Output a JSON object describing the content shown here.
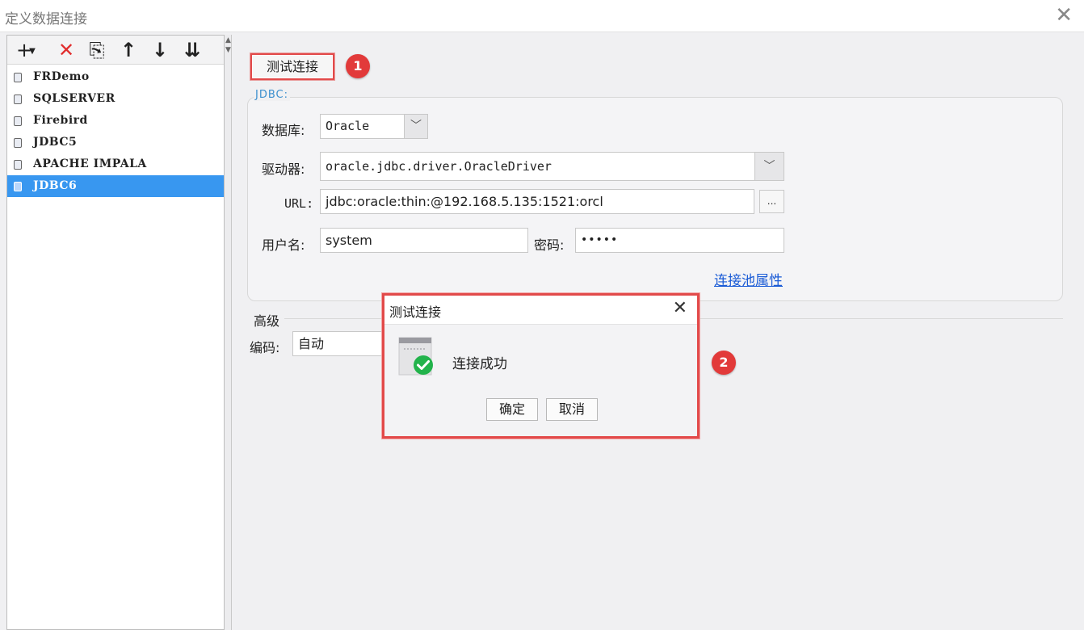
{
  "window": {
    "title": "定义数据连接",
    "close_glyph": "✕"
  },
  "toolbar": {
    "add_glyph": "+",
    "add_caret": "▼",
    "delete_glyph": "✕",
    "copy_glyph": "⎘",
    "up_glyph": "↑",
    "down_glyph": "↓",
    "sort_glyph": "⇊"
  },
  "connections": [
    {
      "label": "FRDemo"
    },
    {
      "label": "SQLSERVER"
    },
    {
      "label": "Firebird"
    },
    {
      "label": "JDBC5"
    },
    {
      "label": "APACHE IMPALA"
    },
    {
      "label": "JDBC6",
      "selected": true
    }
  ],
  "splitter": {
    "up": "▲",
    "down": "▼"
  },
  "test_button": {
    "label": "测试连接"
  },
  "badges": [
    "1",
    "2"
  ],
  "jdbc": {
    "legend": "JDBC:",
    "database_label": "数据库:",
    "database_value": "Oracle",
    "driver_label": "驱动器:",
    "driver_value": "oracle.jdbc.driver.OracleDriver",
    "url_label": "URL:",
    "url_value": "jdbc:oracle:thin:@192.168.5.135:1521:orcl",
    "url_browse": "...",
    "username_label": "用户名:",
    "username_value": "system",
    "password_label": "密码:",
    "password_value": "•••••",
    "pool_link": "连接池属性",
    "combo_arrow": "﹀"
  },
  "advanced": {
    "legend": "高级",
    "encoding_label": "编码:",
    "encoding_value": "自动"
  },
  "dialog": {
    "title": "测试连接",
    "close_glyph": "✕",
    "message": "连接成功",
    "ok_label": "确定",
    "cancel_label": "取消",
    "icon": "connection-success-icon"
  },
  "colors": {
    "highlight_red": "#e24a4a",
    "selection_blue": "#3897f0",
    "link_blue": "#1a5bd6",
    "success_green": "#22b34b"
  }
}
